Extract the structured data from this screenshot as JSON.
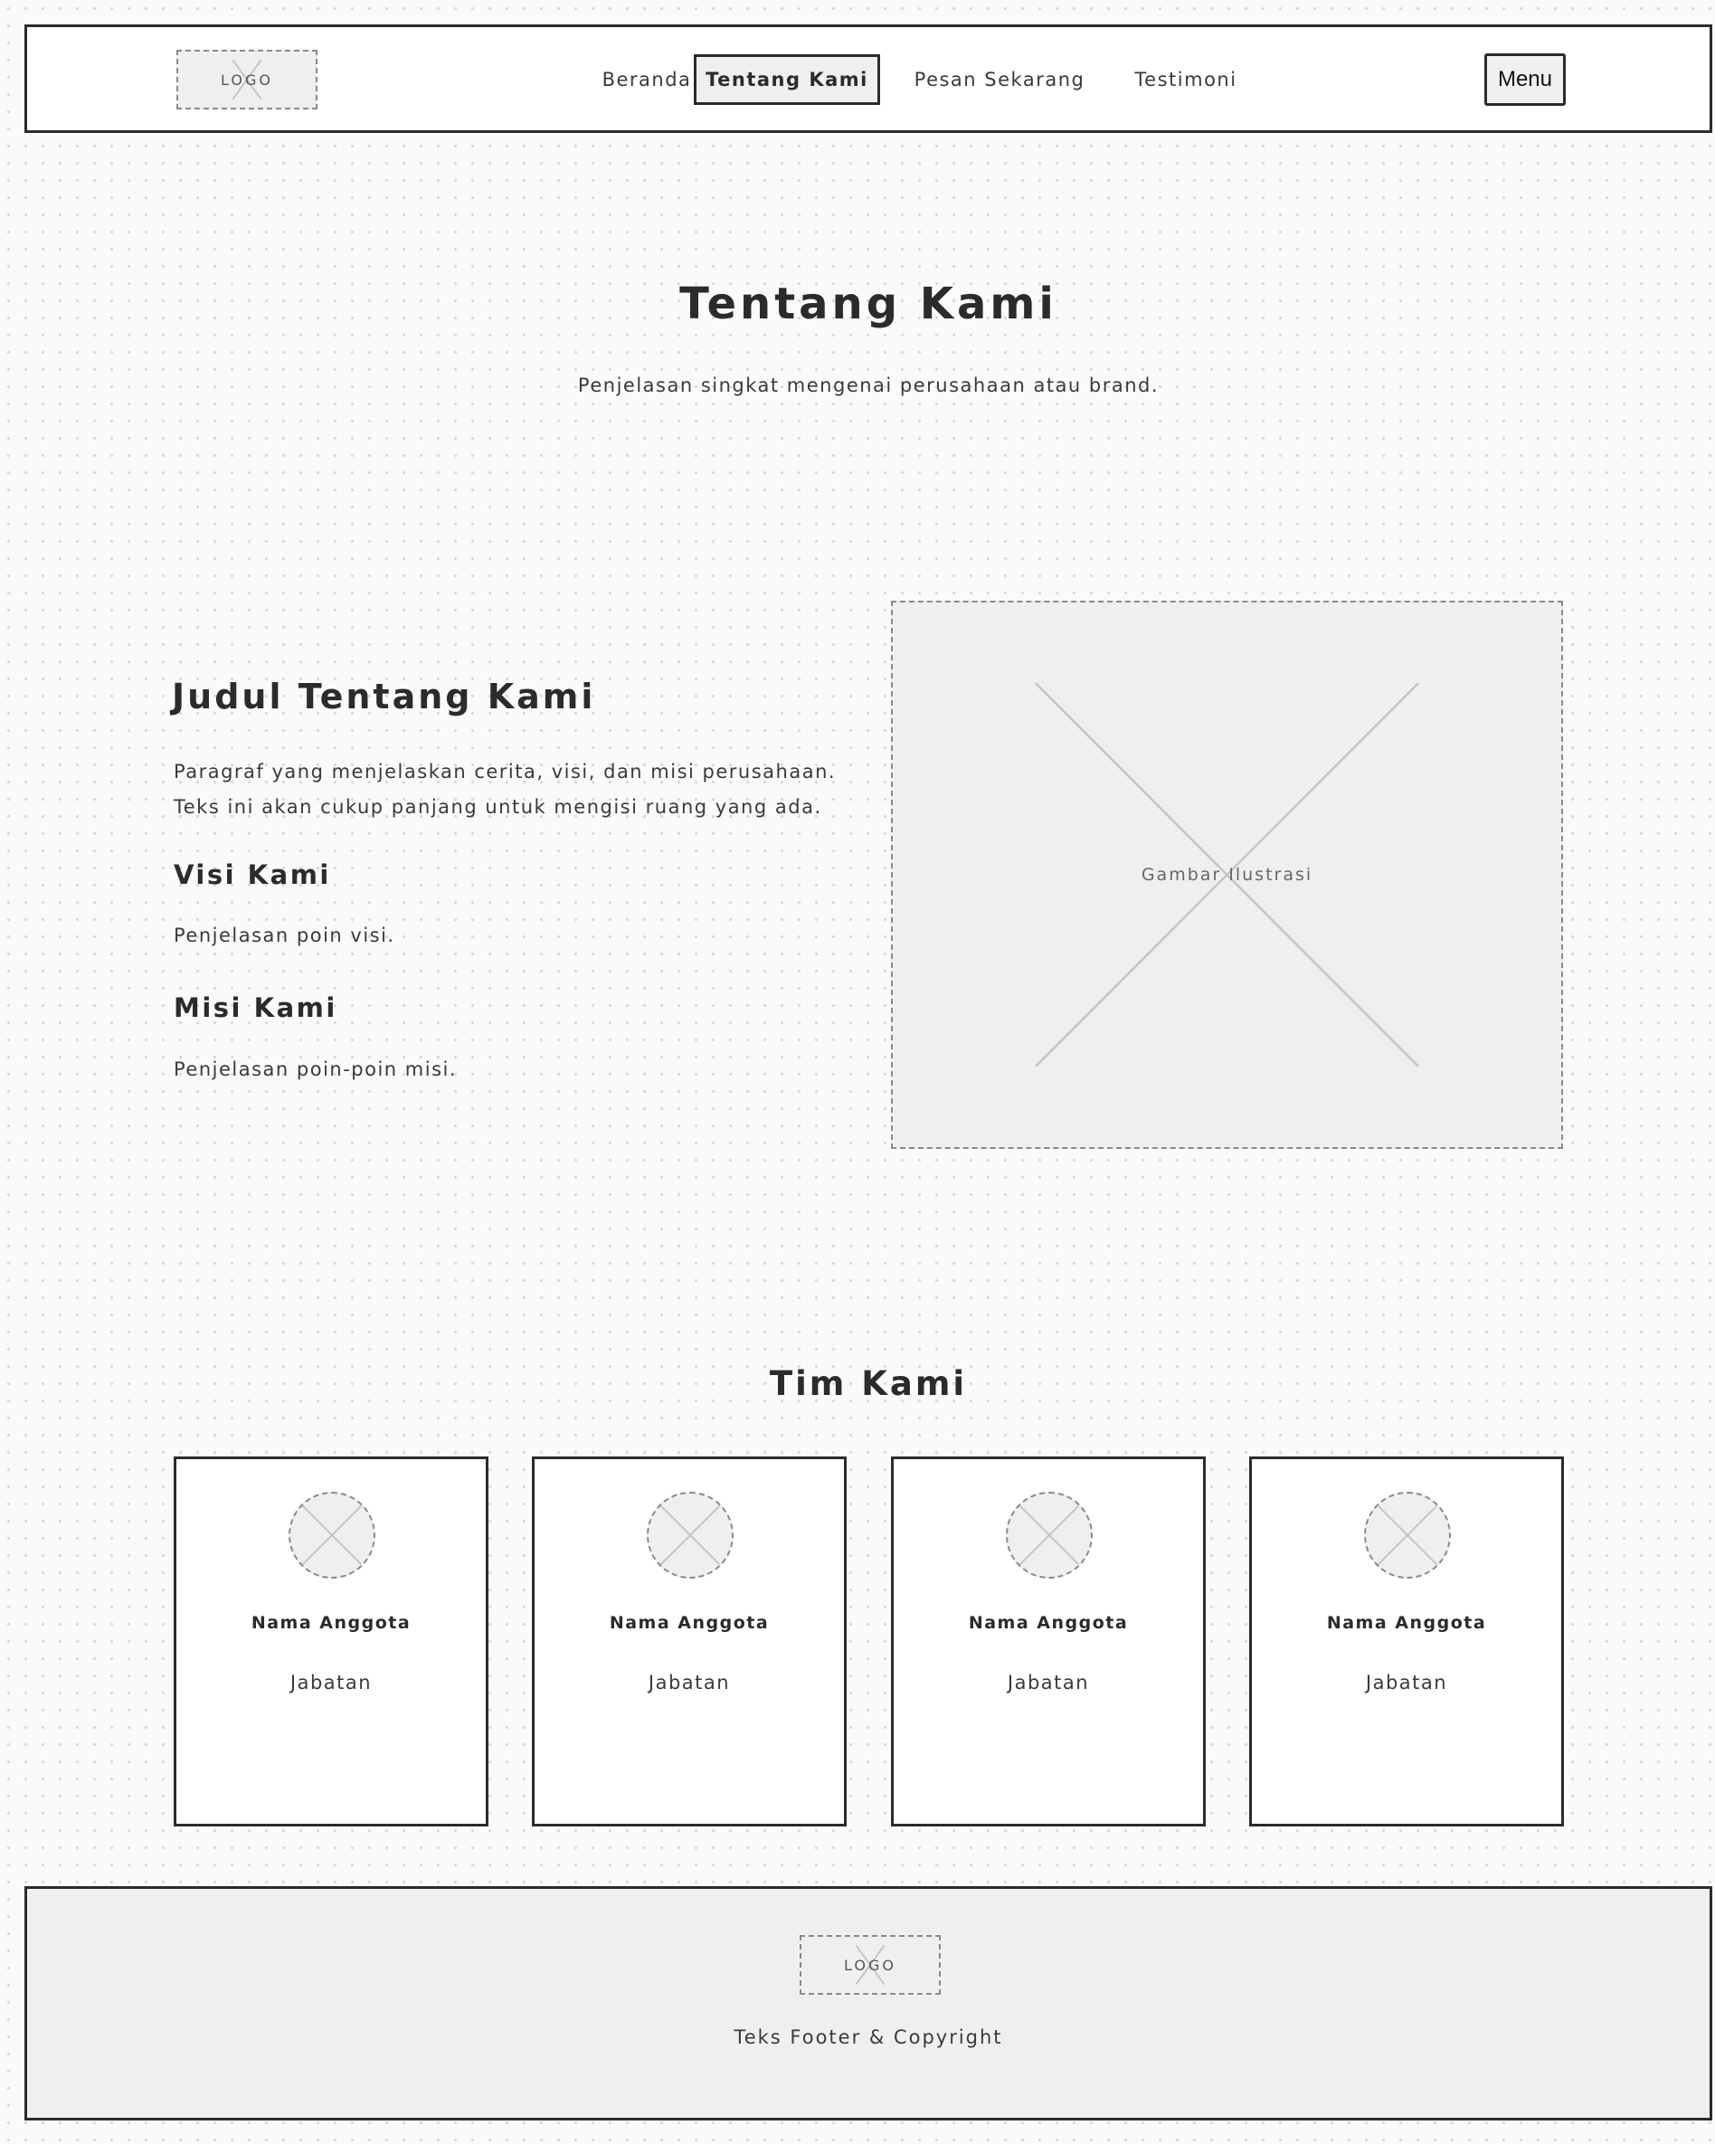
{
  "header": {
    "logo_text": "LOGO",
    "nav": [
      {
        "label": "Beranda",
        "active": false
      },
      {
        "label": "Tentang Kami",
        "active": true
      },
      {
        "label": "Pesan Sekarang",
        "active": false
      },
      {
        "label": "Testimoni",
        "active": false
      }
    ],
    "menu_label": "Menu"
  },
  "hero": {
    "title": "Tentang Kami",
    "subtitle": "Penjelasan singkat mengenai perusahaan atau brand."
  },
  "about": {
    "title": "Judul Tentang Kami",
    "paragraph": "Paragraf yang menjelaskan cerita, visi, dan misi perusahaan. Teks ini akan cukup panjang untuk mengisi ruang yang ada.",
    "vision_title": "Visi Kami",
    "vision_text": "Penjelasan poin visi.",
    "mission_title": "Misi Kami",
    "mission_text": "Penjelasan poin-poin misi.",
    "image_label": "Gambar Ilustrasi"
  },
  "team": {
    "title": "Tim Kami",
    "members": [
      {
        "name": "Nama Anggota",
        "role": "Jabatan"
      },
      {
        "name": "Nama Anggota",
        "role": "Jabatan"
      },
      {
        "name": "Nama Anggota",
        "role": "Jabatan"
      },
      {
        "name": "Nama Anggota",
        "role": "Jabatan"
      }
    ]
  },
  "footer": {
    "logo_text": "LOGO",
    "text": "Teks Footer & Copyright"
  },
  "colors": {
    "border": "#2b2b2b",
    "placeholder_fill": "#efefef",
    "placeholder_stroke": "#8a8a8a",
    "background": "#fafafa"
  }
}
